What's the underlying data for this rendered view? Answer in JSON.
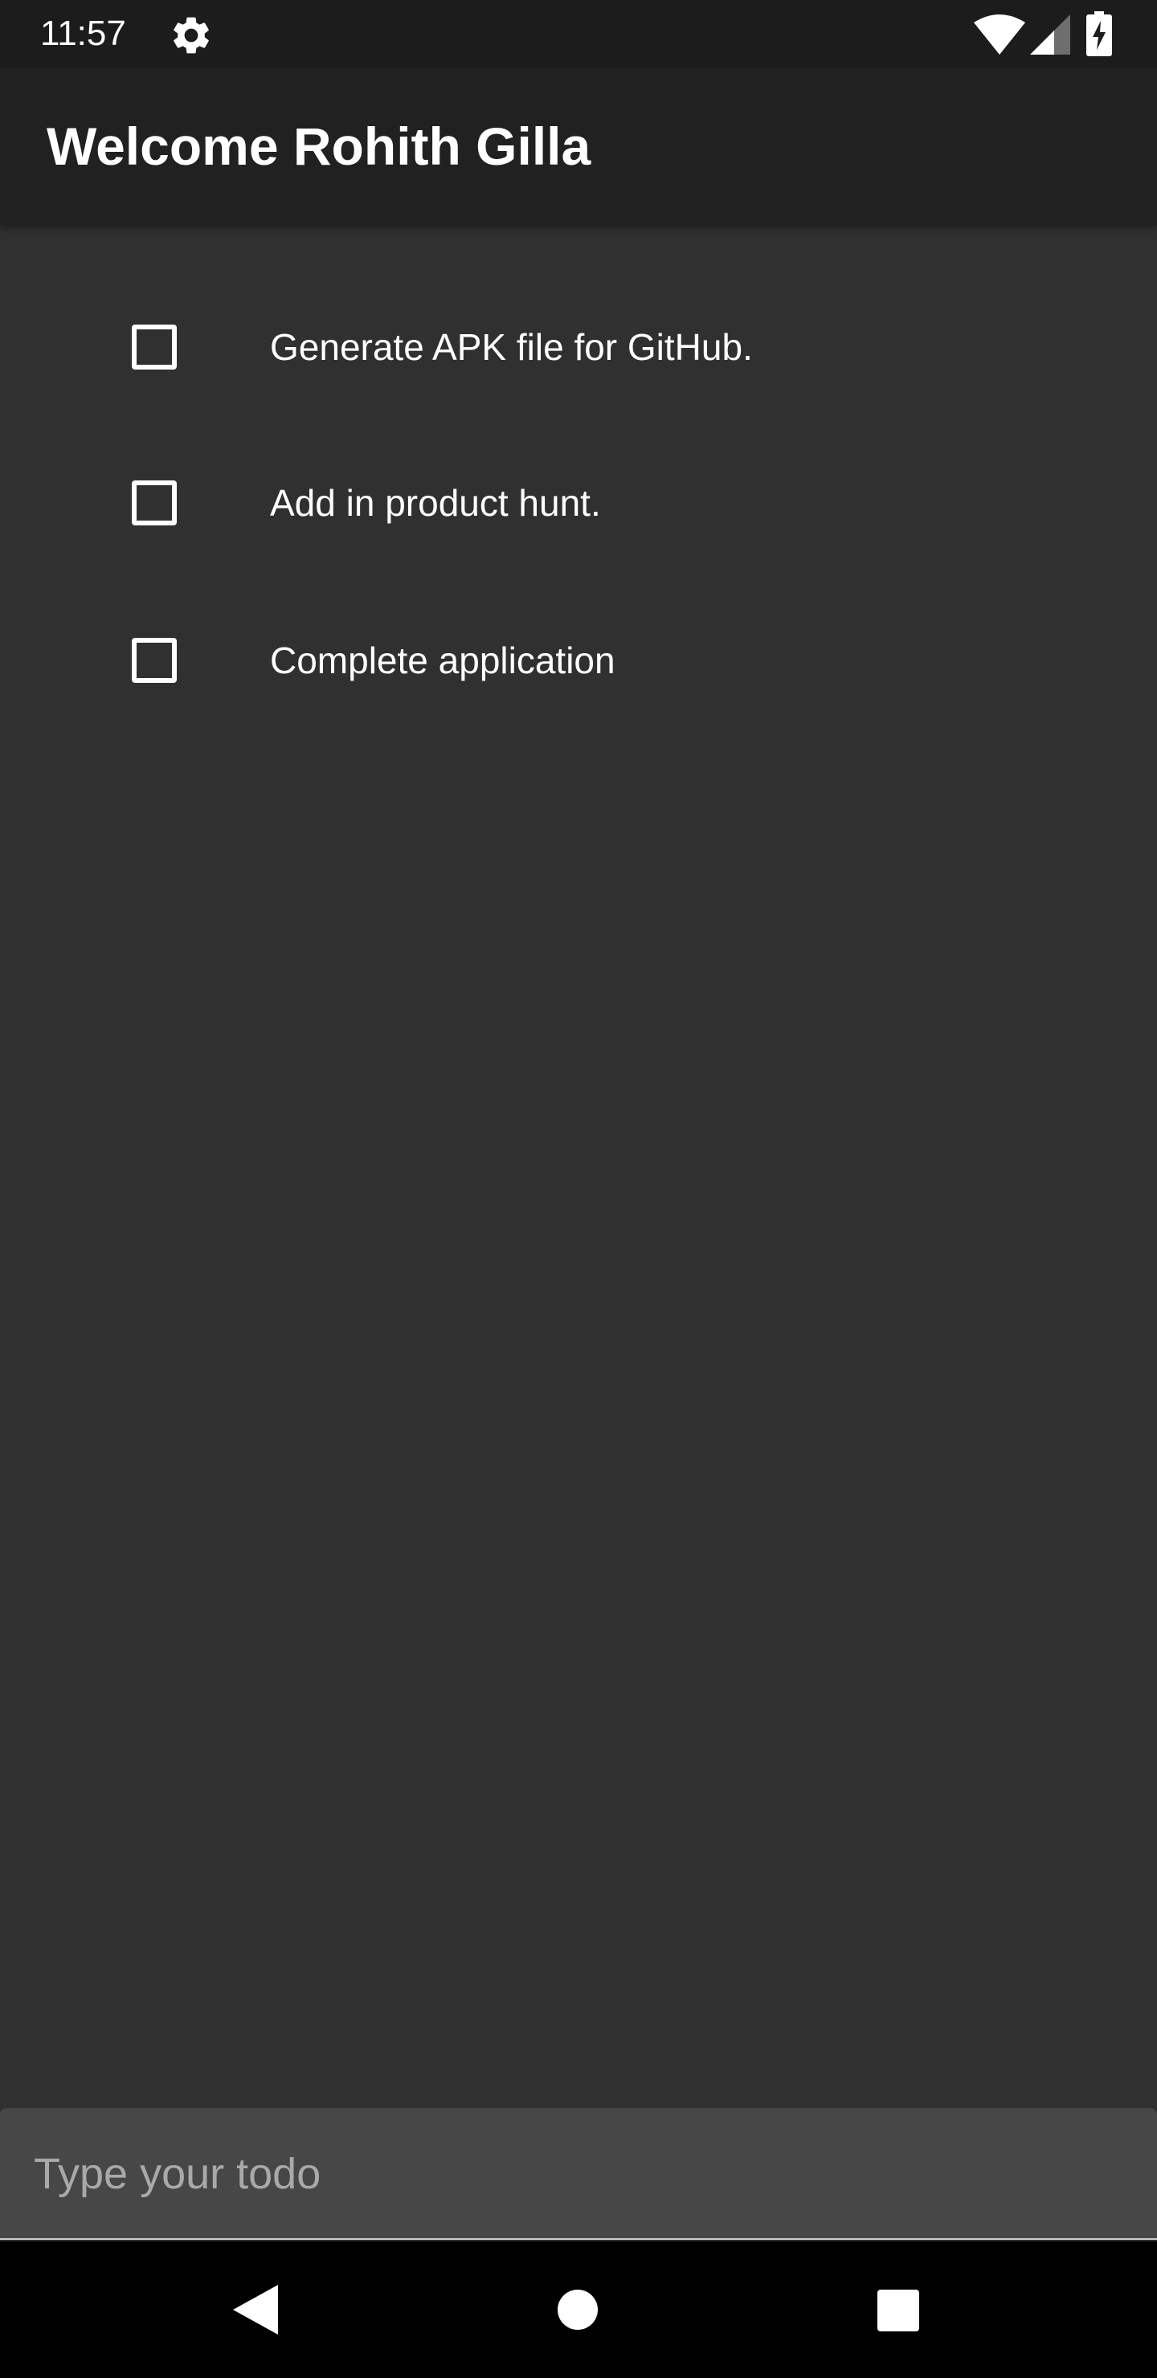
{
  "status_bar": {
    "time": "11:57",
    "icons": [
      "gear-icon",
      "wifi-icon",
      "signal-icon",
      "battery-charging-icon"
    ]
  },
  "app_bar": {
    "title": "Welcome Rohith Gilla",
    "background": "#212121"
  },
  "todos": [
    {
      "label": "Generate APK file for GitHub.",
      "checked": false
    },
    {
      "label": "Add in product hunt.",
      "checked": false
    },
    {
      "label": "Complete application",
      "checked": false
    }
  ],
  "input": {
    "placeholder": "Type your todo",
    "value": ""
  },
  "nav_bar": {
    "icons": [
      "back-icon",
      "home-icon",
      "recents-icon"
    ]
  },
  "colors": {
    "background": "#303030",
    "status_bar": "#1c1c1c",
    "input_background": "#474747",
    "nav_bar": "#000000"
  }
}
